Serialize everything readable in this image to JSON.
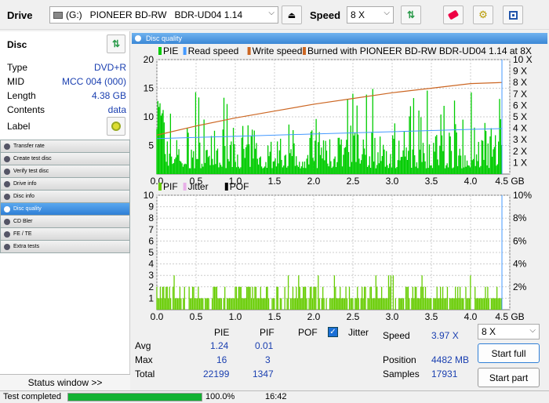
{
  "toolbar": {
    "drive_label": "Drive",
    "drive_value": "(G:)   PIONEER BD-RW   BDR-UD04 1.14",
    "speed_label": "Speed",
    "speed_value": "8 X"
  },
  "disc": {
    "header": "Disc",
    "rows": [
      {
        "key": "Type",
        "value": "DVD+R"
      },
      {
        "key": "MID",
        "value": "MCC 004 (000)"
      },
      {
        "key": "Length",
        "value": "4.38 GB"
      },
      {
        "key": "Contents",
        "value": "data"
      }
    ],
    "label_key": "Label"
  },
  "nav": [
    "Transfer rate",
    "Create test disc",
    "Verify test disc",
    "Drive info",
    "Disc info",
    "Disc quality",
    "CD Bler",
    "FE / TE",
    "Extra tests"
  ],
  "panel_title": "Disc quality",
  "status_window_label": "Status window >>",
  "colors": {
    "pie": "#00cc00",
    "pif": "#66cc00",
    "read": "#4499ff",
    "write": "#cc6622",
    "accent": "#2f7fd6"
  },
  "chart_data": [
    {
      "type": "bar",
      "legend": [
        "PIE",
        "Read speed",
        "Write speed",
        "Burned with PIONEER BD-RW   BDR-UD04 1.14 at 8X"
      ],
      "xlim": [
        0,
        4.5
      ],
      "ylim": [
        0,
        20
      ],
      "x_ticks": [
        "0.0",
        "0.5",
        "1.0",
        "1.5",
        "2.0",
        "2.5",
        "3.0",
        "3.5",
        "4.0",
        "4.5 GB"
      ],
      "y_ticks": [
        "5",
        "10",
        "15",
        "20"
      ],
      "y2_ticks": [
        "1 X",
        "2 X",
        "3 X",
        "4 X",
        "5 X",
        "6 X",
        "7 X",
        "8 X",
        "9 X",
        "10 X"
      ],
      "y2lim": [
        0,
        10
      ],
      "write_speed": {
        "x": [
          0,
          0.5,
          1.0,
          1.5,
          2.0,
          2.5,
          3.0,
          3.5,
          4.0,
          4.4
        ],
        "y": [
          3.4,
          4.2,
          4.9,
          5.5,
          6.1,
          6.6,
          7.1,
          7.5,
          7.9,
          8.0
        ]
      },
      "read_speed": {
        "x": [
          0,
          1.0,
          2.0,
          3.0,
          4.0,
          4.4
        ],
        "y": [
          3.1,
          3.3,
          3.5,
          3.7,
          3.9,
          3.97
        ]
      }
    },
    {
      "type": "bar",
      "legend": [
        "PIF",
        "Jitter",
        "POF"
      ],
      "xlim": [
        0,
        4.5
      ],
      "ylim": [
        0,
        10
      ],
      "x_ticks": [
        "0.0",
        "0.5",
        "1.0",
        "1.5",
        "2.0",
        "2.5",
        "3.0",
        "3.5",
        "4.0",
        "4.5 GB"
      ],
      "y_ticks": [
        "1",
        "2",
        "3",
        "4",
        "5",
        "6",
        "7",
        "8",
        "9",
        "10"
      ],
      "y2_ticks": [
        "2%",
        "4%",
        "6%",
        "8%",
        "10%"
      ]
    }
  ],
  "stats": {
    "col_pie": "PIE",
    "col_pif": "PIF",
    "col_pof": "POF",
    "jitter_label": "Jitter",
    "avg_label": "Avg",
    "avg_pie": "1.24",
    "avg_pif": "0.01",
    "max_label": "Max",
    "max_pie": "16",
    "max_pif": "3",
    "total_label": "Total",
    "total_pie": "22199",
    "total_pif": "1347",
    "speed_label": "Speed",
    "speed_value": "3.97 X",
    "position_label": "Position",
    "position_value": "4482 MB",
    "samples_label": "Samples",
    "samples_value": "17931",
    "speed_select": "8 X",
    "start_full": "Start full",
    "start_part": "Start part"
  },
  "statusbar": {
    "text": "Test completed",
    "progress": 100,
    "percent": "100.0%",
    "time": "16:42"
  }
}
